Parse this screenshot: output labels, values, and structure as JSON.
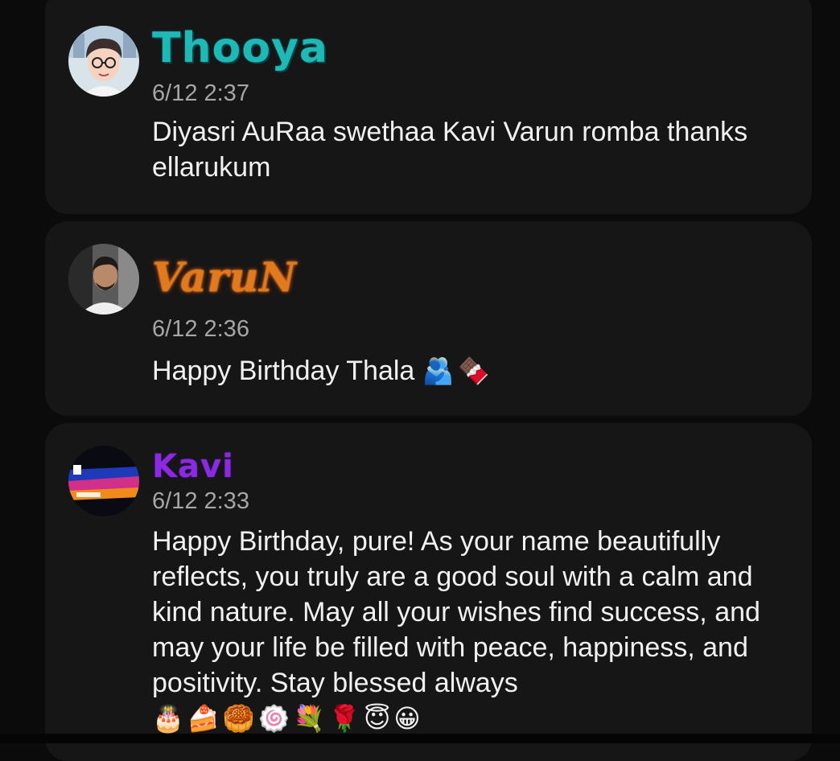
{
  "posts": [
    {
      "author": "Thooya",
      "author_color": "#1fb8b4",
      "avatar": "cartoon-boy-glasses-avatar",
      "time": "6/12 2:37",
      "message": "Diyasri AuRaa swethaa Kavi Varun romba thanks ellarukum"
    },
    {
      "author": "VaruN",
      "author_color": "#e07a1f",
      "avatar": "man-portrait-avatar",
      "time": "6/12 2:36",
      "message": "Happy Birthday Thala",
      "emojis": [
        "🫂",
        "🍫"
      ]
    },
    {
      "author": "Kavi",
      "author_color": "#8a2be2",
      "avatar": "celebration-banner-avatar",
      "time": "6/12 2:33",
      "message": "Happy Birthday, pure! As your name beautifully reflects, you truly are a good soul with a calm and kind nature. May all your wishes find success, and may your life be filled with peace, happiness, and positivity. Stay blessed always",
      "emojis": [
        "🎂",
        "🍰",
        "🥮",
        "🍥",
        "💐",
        "🌹",
        "😇",
        "😀"
      ]
    }
  ]
}
